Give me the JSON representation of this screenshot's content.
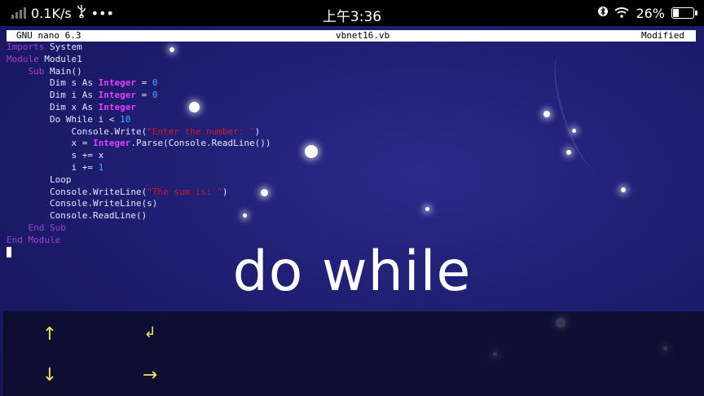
{
  "status_bar": {
    "network_speed": "0.1K/s",
    "usb_icon": "usb-icon",
    "more_icon": "•••",
    "time": "上午3:36",
    "battery_percent": "26%",
    "battery_level": 0.26
  },
  "nano": {
    "version": "GNU nano 6.3",
    "filename": "vbnet16.vb",
    "state": "Modified"
  },
  "code_lines": [
    [
      {
        "t": "Imports",
        "c": "kw"
      },
      {
        "t": " System"
      }
    ],
    [
      {
        "t": "Module",
        "c": "kw"
      },
      {
        "t": " Module1"
      }
    ],
    [
      {
        "t": "    "
      },
      {
        "t": "Sub",
        "c": "kw"
      },
      {
        "t": " Main()"
      }
    ],
    [
      {
        "t": "        Dim s As "
      },
      {
        "t": "Integer",
        "c": "ty"
      },
      {
        "t": " = "
      },
      {
        "t": "0",
        "c": "num"
      }
    ],
    [
      {
        "t": "        Dim i As "
      },
      {
        "t": "Integer",
        "c": "ty"
      },
      {
        "t": " = "
      },
      {
        "t": "0",
        "c": "num"
      }
    ],
    [
      {
        "t": "        Dim x As "
      },
      {
        "t": "Integer",
        "c": "ty"
      }
    ],
    [
      {
        "t": "        Do While i < "
      },
      {
        "t": "10",
        "c": "num"
      }
    ],
    [
      {
        "t": "            Console.Write("
      },
      {
        "t": "\"Enter the number: \"",
        "c": "str"
      },
      {
        "t": ")"
      }
    ],
    [
      {
        "t": "            x = "
      },
      {
        "t": "Integer",
        "c": "ty"
      },
      {
        "t": ".Parse(Console.ReadLine())"
      }
    ],
    [
      {
        "t": "            s += x"
      }
    ],
    [
      {
        "t": "            i += "
      },
      {
        "t": "1",
        "c": "num"
      }
    ],
    [
      {
        "t": "        Loop"
      }
    ],
    [
      {
        "t": "        Console.WriteLine("
      },
      {
        "t": "\"The sum is: \"",
        "c": "str"
      },
      {
        "t": ")"
      }
    ],
    [
      {
        "t": "        Console.WriteLine(s)"
      }
    ],
    [
      {
        "t": "        Console.ReadLine()"
      }
    ],
    [
      {
        "t": "    "
      },
      {
        "t": "End Sub",
        "c": "kw"
      }
    ],
    [
      {
        "t": "End Module",
        "c": "kw"
      }
    ]
  ],
  "caption": "do while",
  "extra_keys": {
    "up": "↑",
    "enter": "↲",
    "down": "↓",
    "right": "→"
  },
  "colors": {
    "keyword": "#a43fd6",
    "type": "#e040ff",
    "number": "#4aa8ff",
    "string": "#d01c1c",
    "key_arrow": "#f2e35a"
  }
}
